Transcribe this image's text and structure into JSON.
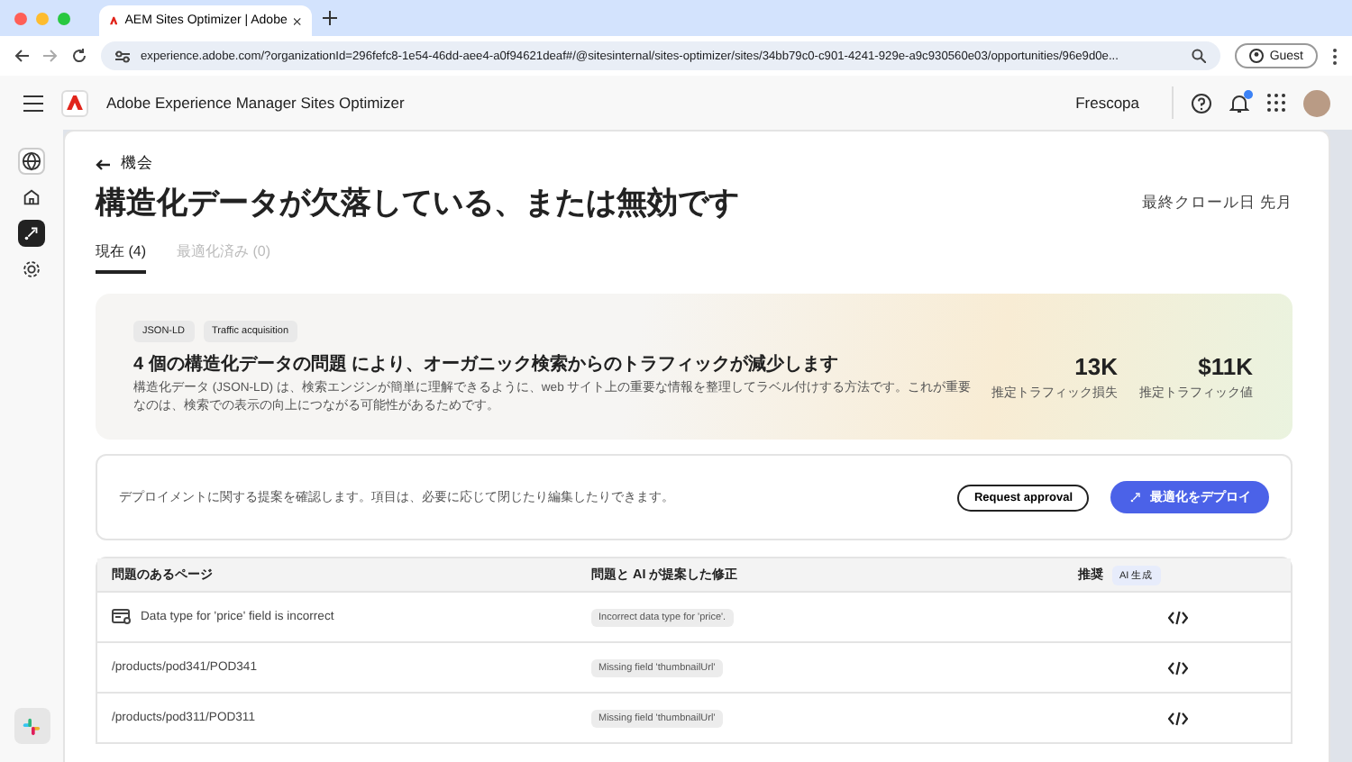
{
  "browser": {
    "tab_title": "AEM Sites Optimizer | Adobe",
    "url": "experience.adobe.com/?organizationId=296fefc8-1e54-46dd-aee4-a0f94621deaf#/@sitesinternal/sites-optimizer/sites/34bb79c0-c901-4241-929e-a9c930560e03/opportunities/96e9d0e...",
    "profile": "Guest"
  },
  "header": {
    "product": "Adobe Experience Manager Sites Optimizer",
    "org": "Frescopa",
    "notification_badge": true
  },
  "sidebar": {
    "items": [
      {
        "kind": "globe",
        "selected": false
      },
      {
        "kind": "home",
        "selected": false
      },
      {
        "kind": "opportunities",
        "selected": true
      },
      {
        "kind": "settings",
        "selected": false
      }
    ]
  },
  "page": {
    "back_link": "機会",
    "title": "構造化データが欠落している、または無効です",
    "last_crawl": "最終クロール日 先月",
    "tabs": [
      {
        "label": "現在 (4)",
        "selected": true
      },
      {
        "label": "最適化済み (0)",
        "selected": false
      }
    ],
    "summary": {
      "tags": [
        "JSON-LD",
        "Traffic acquisition"
      ],
      "heading": "4 個の構造化データの問題 により、オーガニック検索からのトラフィックが減少します",
      "description": "構造化データ (JSON-LD) は、検索エンジンが簡単に理解できるように、web サイト上の重要な情報を整理してラベル付けする方法です。これが重要なのは、検索での表示の向上につながる可能性があるためです。",
      "metrics": [
        {
          "value": "13K",
          "label": "推定トラフィック損失"
        },
        {
          "value": "$11K",
          "label": "推定トラフィック値"
        }
      ]
    },
    "deploy": {
      "text": "デプロイメントに関する提案を確認します。項目は、必要に応じて閉じたり編集したりできます。",
      "request_button": "Request approval",
      "deploy_button": "最適化をデプロイ"
    },
    "table": {
      "columns": [
        "問題のあるページ",
        "問題と AI が提案した修正",
        "推奨"
      ],
      "ai_badge": "AI 生成",
      "rows": [
        {
          "page": "Data type for 'price' field is incorrect",
          "has_icon": true,
          "fix": "Incorrect data type for 'price'."
        },
        {
          "page": "/products/pod341/POD341",
          "has_icon": false,
          "fix": "Missing field 'thumbnailUrl'"
        },
        {
          "page": "/products/pod311/POD311",
          "has_icon": false,
          "fix": "Missing field 'thumbnailUrl'"
        }
      ]
    }
  }
}
